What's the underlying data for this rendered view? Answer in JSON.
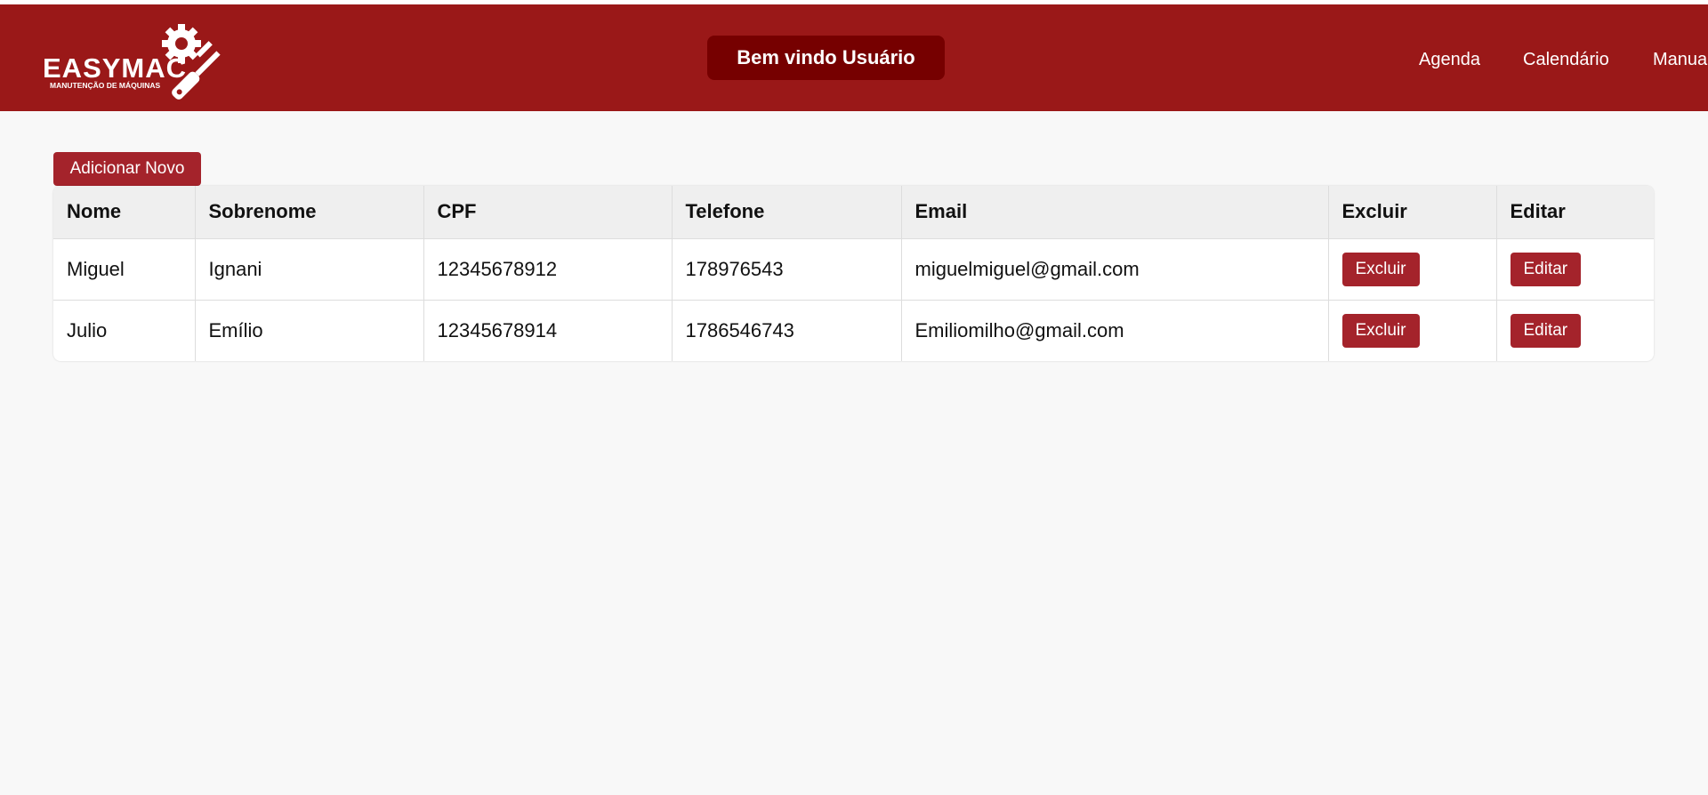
{
  "header": {
    "logo": {
      "brand": "EASYMAC",
      "tagline": "MANUTENÇÃO DE MÁQUINAS",
      "icon": "gear-wrench-screwdriver-icon"
    },
    "welcome": "Bem vindo Usuário",
    "nav": [
      "Agenda",
      "Calendário",
      "Manua"
    ],
    "color": "#9a1818"
  },
  "toolbar": {
    "add_label": "Adicionar Novo"
  },
  "table": {
    "columns": [
      "Nome",
      "Sobrenome",
      "CPF",
      "Telefone",
      "Email",
      "Excluir",
      "Editar"
    ],
    "rows": [
      {
        "nome": "Miguel",
        "sobrenome": "Ignani",
        "cpf": "12345678912",
        "telefone": "178976543",
        "email": "miguelmiguel@gmail.com",
        "excluir": "Excluir",
        "editar": "Editar"
      },
      {
        "nome": "Julio",
        "sobrenome": "Emílio",
        "cpf": "12345678914",
        "telefone": "1786546743",
        "email": "Emiliomilho@gmail.com",
        "excluir": "Excluir",
        "editar": "Editar"
      }
    ]
  },
  "colors": {
    "accent": "#a4232b",
    "welcome_bg": "#760000"
  }
}
